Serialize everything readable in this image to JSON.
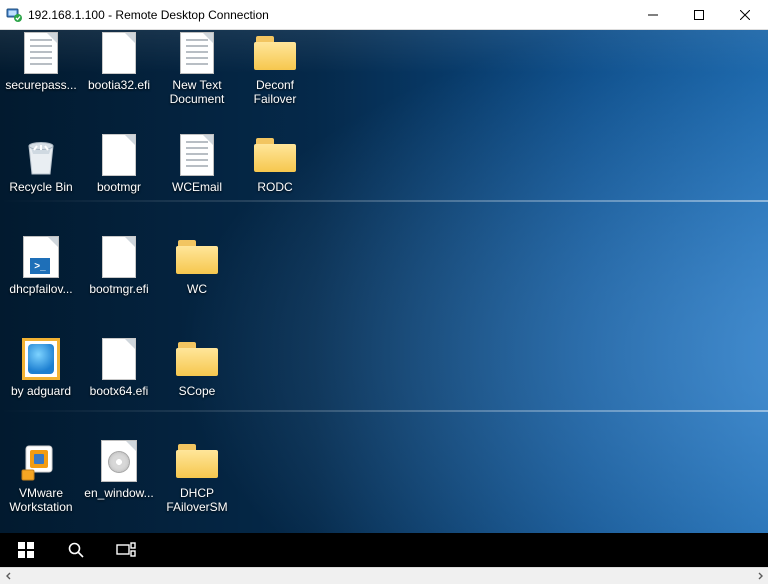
{
  "window": {
    "title": "192.168.1.100 - Remote Desktop Connection",
    "buttons": {
      "min": "minimize",
      "max": "maximize",
      "close": "close"
    }
  },
  "desktop": {
    "grid_cols": 4,
    "icons": [
      {
        "name": "securepass-file",
        "type": "text",
        "label": "securepass..."
      },
      {
        "name": "bootia32-efi",
        "type": "blank",
        "label": "bootia32.efi"
      },
      {
        "name": "new-text-doc",
        "type": "text",
        "label": "New Text Document"
      },
      {
        "name": "deconf-failover",
        "type": "folder",
        "label": "Deconf Failover"
      },
      {
        "name": "recycle-bin",
        "type": "recycle",
        "label": "Recycle Bin"
      },
      {
        "name": "bootmgr",
        "type": "blank",
        "label": "bootmgr"
      },
      {
        "name": "wcemail",
        "type": "text",
        "label": "WCEmail"
      },
      {
        "name": "rodc",
        "type": "folder",
        "label": "RODC"
      },
      {
        "name": "dhcpfailover-ps1",
        "type": "ps1",
        "label": "dhcpfailov..."
      },
      {
        "name": "bootmgr-efi",
        "type": "blank",
        "label": "bootmgr.efi"
      },
      {
        "name": "wc-folder",
        "type": "folder",
        "label": "WC"
      },
      {
        "name": "empty-1",
        "type": "empty",
        "label": ""
      },
      {
        "name": "by-adguard",
        "type": "chm",
        "label": "by adguard"
      },
      {
        "name": "bootx64-efi",
        "type": "blank",
        "label": "bootx64.efi"
      },
      {
        "name": "scope-folder",
        "type": "folder",
        "label": "SCope"
      },
      {
        "name": "empty-2",
        "type": "empty",
        "label": ""
      },
      {
        "name": "vmware-workstation",
        "type": "vmware",
        "label": "VMware Workstation"
      },
      {
        "name": "en-windows-iso",
        "type": "iso",
        "label": "en_window..."
      },
      {
        "name": "dhcp-failoversm",
        "type": "folder",
        "label": "DHCP FAiloverSM"
      },
      {
        "name": "empty-3",
        "type": "empty",
        "label": ""
      }
    ]
  },
  "remote_taskbar": {
    "start": "start-menu",
    "search": "search",
    "taskview": "task-view"
  },
  "host_scrollbar": {
    "left": "scroll-left",
    "right": "scroll-right"
  }
}
